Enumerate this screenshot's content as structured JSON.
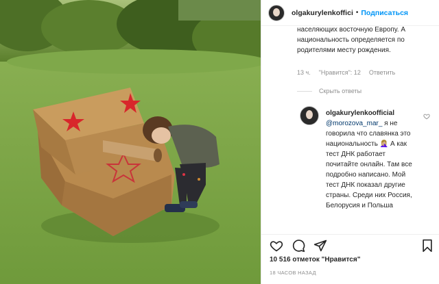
{
  "header": {
    "username": "olgakurylenkoffici",
    "separator": "•",
    "follow_label": "Подписаться",
    "more_label": "···"
  },
  "comment1": {
    "text": "населяющих восточную Европу. А национальность определяется по родителями месту рождения.",
    "time": "13 ч.",
    "likes": "\"Нравится\": 12",
    "reply": "Ответить"
  },
  "replies_toggle": {
    "label": "Скрыть ответы"
  },
  "comment2": {
    "username": "olgakurylenkoofficial",
    "mention": "@morozova_mar_",
    "text": " я не говорила что славянка это национальность 🤦🏼‍♀️ А как тест ДНК работает почитайте онлайн. Там все подробно написано. Мой тест ДНК показал другие страны. Среди них Россия, Белорусия и Польша"
  },
  "post": {
    "likes_text": "10 516 отметок \"Нравится\"",
    "timestamp": "18 ЧАСОВ НАЗАД"
  },
  "icons": {
    "like": "heart-icon",
    "comment": "comment-icon",
    "share": "share-icon",
    "save": "bookmark-icon"
  },
  "colors": {
    "link": "#0095f6",
    "text": "#262626",
    "muted": "#8e8e8e",
    "star": "#d8262b"
  }
}
